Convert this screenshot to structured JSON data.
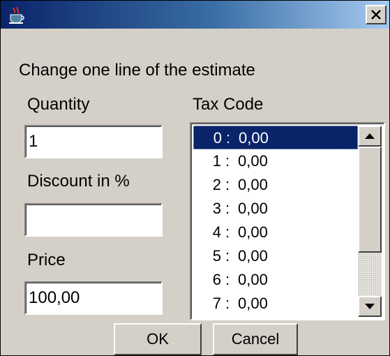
{
  "dialog": {
    "title": "",
    "heading": "Change one line of the estimate"
  },
  "fields": {
    "quantity_label": "Quantity",
    "quantity_value": "1",
    "discount_label": "Discount in %",
    "discount_value": "",
    "price_label": "Price",
    "price_value": "100,00"
  },
  "tax": {
    "label": "Tax Code",
    "selected_index": 0,
    "items": [
      {
        "code": "0",
        "sep": ":",
        "rate": "0,00"
      },
      {
        "code": "1",
        "sep": ":",
        "rate": "0,00"
      },
      {
        "code": "2",
        "sep": ":",
        "rate": "0,00"
      },
      {
        "code": "3",
        "sep": ":",
        "rate": "0,00"
      },
      {
        "code": "4",
        "sep": ":",
        "rate": "0,00"
      },
      {
        "code": "5",
        "sep": ":",
        "rate": "0,00"
      },
      {
        "code": "6",
        "sep": ":",
        "rate": "0,00"
      },
      {
        "code": "7",
        "sep": ":",
        "rate": "0,00"
      }
    ]
  },
  "buttons": {
    "ok": "OK",
    "cancel": "Cancel"
  },
  "icons": {
    "app": "java-cup-icon",
    "close": "close-icon",
    "scroll_up": "arrow-up-icon",
    "scroll_down": "arrow-down-icon"
  },
  "colors": {
    "titlebar_start": "#0a246a",
    "titlebar_end": "#a6caf0",
    "dialog_bg": "#d4d0c8",
    "selection_bg": "#0a246a"
  }
}
